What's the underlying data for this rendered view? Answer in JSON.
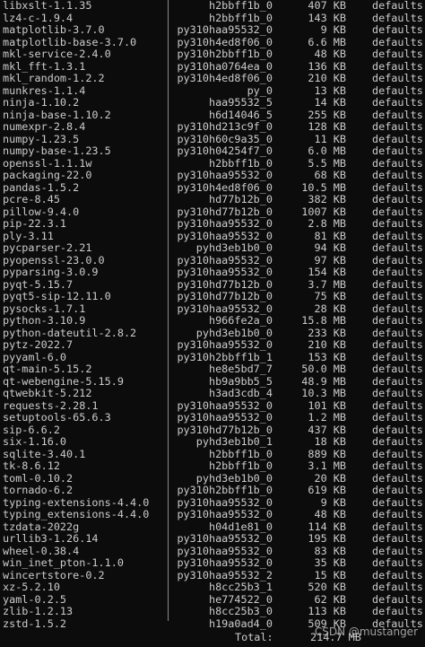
{
  "terminal": {
    "packages": [
      {
        "name": "libxslt-1.1.35",
        "build": "h2bbff1b_0",
        "size": "407 KB",
        "channel": "defaults"
      },
      {
        "name": "lz4-c-1.9.4",
        "build": "h2bbff1b_0",
        "size": "143 KB",
        "channel": "defaults"
      },
      {
        "name": "matplotlib-3.7.0",
        "build": "py310haa95532_0",
        "size": "9 KB",
        "channel": "defaults"
      },
      {
        "name": "matplotlib-base-3.7.0",
        "build": "py310h4ed8f06_0",
        "size": "6.6 MB",
        "channel": "defaults"
      },
      {
        "name": "mkl-service-2.4.0",
        "build": "py310h2bbff1b_0",
        "size": "48 KB",
        "channel": "defaults"
      },
      {
        "name": "mkl_fft-1.3.1",
        "build": "py310ha0764ea_0",
        "size": "136 KB",
        "channel": "defaults"
      },
      {
        "name": "mkl_random-1.2.2",
        "build": "py310h4ed8f06_0",
        "size": "210 KB",
        "channel": "defaults"
      },
      {
        "name": "munkres-1.1.4",
        "build": "py_0",
        "size": "13 KB",
        "channel": "defaults"
      },
      {
        "name": "ninja-1.10.2",
        "build": "haa95532_5",
        "size": "14 KB",
        "channel": "defaults"
      },
      {
        "name": "ninja-base-1.10.2",
        "build": "h6d14046_5",
        "size": "255 KB",
        "channel": "defaults"
      },
      {
        "name": "numexpr-2.8.4",
        "build": "py310hd213c9f_0",
        "size": "128 KB",
        "channel": "defaults"
      },
      {
        "name": "numpy-1.23.5",
        "build": "py310h60c9a35_0",
        "size": "11 KB",
        "channel": "defaults"
      },
      {
        "name": "numpy-base-1.23.5",
        "build": "py310h04254f7_0",
        "size": "6.0 MB",
        "channel": "defaults"
      },
      {
        "name": "openssl-1.1.1w",
        "build": "h2bbff1b_0",
        "size": "5.5 MB",
        "channel": "defaults"
      },
      {
        "name": "packaging-22.0",
        "build": "py310haa95532_0",
        "size": "68 KB",
        "channel": "defaults"
      },
      {
        "name": "pandas-1.5.2",
        "build": "py310h4ed8f06_0",
        "size": "10.5 MB",
        "channel": "defaults"
      },
      {
        "name": "pcre-8.45",
        "build": "hd77b12b_0",
        "size": "382 KB",
        "channel": "defaults"
      },
      {
        "name": "pillow-9.4.0",
        "build": "py310hd77b12b_0",
        "size": "1007 KB",
        "channel": "defaults"
      },
      {
        "name": "pip-22.3.1",
        "build": "py310haa95532_0",
        "size": "2.8 MB",
        "channel": "defaults"
      },
      {
        "name": "ply-3.11",
        "build": "py310haa95532_0",
        "size": "81 KB",
        "channel": "defaults"
      },
      {
        "name": "pycparser-2.21",
        "build": "pyhd3eb1b0_0",
        "size": "94 KB",
        "channel": "defaults"
      },
      {
        "name": "pyopenssl-23.0.0",
        "build": "py310haa95532_0",
        "size": "97 KB",
        "channel": "defaults"
      },
      {
        "name": "pyparsing-3.0.9",
        "build": "py310haa95532_0",
        "size": "154 KB",
        "channel": "defaults"
      },
      {
        "name": "pyqt-5.15.7",
        "build": "py310hd77b12b_0",
        "size": "3.7 MB",
        "channel": "defaults"
      },
      {
        "name": "pyqt5-sip-12.11.0",
        "build": "py310hd77b12b_0",
        "size": "75 KB",
        "channel": "defaults"
      },
      {
        "name": "pysocks-1.7.1",
        "build": "py310haa95532_0",
        "size": "28 KB",
        "channel": "defaults"
      },
      {
        "name": "python-3.10.9",
        "build": "h966fe2a_0",
        "size": "15.8 MB",
        "channel": "defaults"
      },
      {
        "name": "python-dateutil-2.8.2",
        "build": "pyhd3eb1b0_0",
        "size": "233 KB",
        "channel": "defaults"
      },
      {
        "name": "pytz-2022.7",
        "build": "py310haa95532_0",
        "size": "210 KB",
        "channel": "defaults"
      },
      {
        "name": "pyyaml-6.0",
        "build": "py310h2bbff1b_1",
        "size": "153 KB",
        "channel": "defaults"
      },
      {
        "name": "qt-main-5.15.2",
        "build": "he8e5bd7_7",
        "size": "50.0 MB",
        "channel": "defaults"
      },
      {
        "name": "qt-webengine-5.15.9",
        "build": "hb9a9bb5_5",
        "size": "48.9 MB",
        "channel": "defaults"
      },
      {
        "name": "qtwebkit-5.212",
        "build": "h3ad3cdb_4",
        "size": "10.3 MB",
        "channel": "defaults"
      },
      {
        "name": "requests-2.28.1",
        "build": "py310haa95532_0",
        "size": "101 KB",
        "channel": "defaults"
      },
      {
        "name": "setuptools-65.6.3",
        "build": "py310haa95532_0",
        "size": "1.2 MB",
        "channel": "defaults"
      },
      {
        "name": "sip-6.6.2",
        "build": "py310hd77b12b_0",
        "size": "437 KB",
        "channel": "defaults"
      },
      {
        "name": "six-1.16.0",
        "build": "pyhd3eb1b0_1",
        "size": "18 KB",
        "channel": "defaults"
      },
      {
        "name": "sqlite-3.40.1",
        "build": "h2bbff1b_0",
        "size": "889 KB",
        "channel": "defaults"
      },
      {
        "name": "tk-8.6.12",
        "build": "h2bbff1b_0",
        "size": "3.1 MB",
        "channel": "defaults"
      },
      {
        "name": "toml-0.10.2",
        "build": "pyhd3eb1b0_0",
        "size": "20 KB",
        "channel": "defaults"
      },
      {
        "name": "tornado-6.2",
        "build": "py310h2bbff1b_0",
        "size": "619 KB",
        "channel": "defaults"
      },
      {
        "name": "typing-extensions-4.4.0",
        "build": "py310haa95532_0",
        "size": "9 KB",
        "channel": "defaults"
      },
      {
        "name": "typing_extensions-4.4.0",
        "build": "py310haa95532_0",
        "size": "48 KB",
        "channel": "defaults"
      },
      {
        "name": "tzdata-2022g",
        "build": "h04d1e81_0",
        "size": "114 KB",
        "channel": "defaults"
      },
      {
        "name": "urllib3-1.26.14",
        "build": "py310haa95532_0",
        "size": "195 KB",
        "channel": "defaults"
      },
      {
        "name": "wheel-0.38.4",
        "build": "py310haa95532_0",
        "size": "83 KB",
        "channel": "defaults"
      },
      {
        "name": "win_inet_pton-1.1.0",
        "build": "py310haa95532_0",
        "size": "35 KB",
        "channel": "defaults"
      },
      {
        "name": "wincertstore-0.2",
        "build": "py310haa95532_2",
        "size": "15 KB",
        "channel": "defaults"
      },
      {
        "name": "xz-5.2.10",
        "build": "h8cc25b3_1",
        "size": "520 KB",
        "channel": "defaults"
      },
      {
        "name": "yaml-0.2.5",
        "build": "he774522_0",
        "size": "62 KB",
        "channel": "defaults"
      },
      {
        "name": "zlib-1.2.13",
        "build": "h8cc25b3_0",
        "size": "113 KB",
        "channel": "defaults"
      },
      {
        "name": "zstd-1.5.2",
        "build": "h19a0ad4_0",
        "size": "509 KB",
        "channel": "defaults"
      }
    ],
    "total_label": "Total:",
    "total_value": "214.7 MB"
  },
  "watermark": "CSDN @mustanger"
}
